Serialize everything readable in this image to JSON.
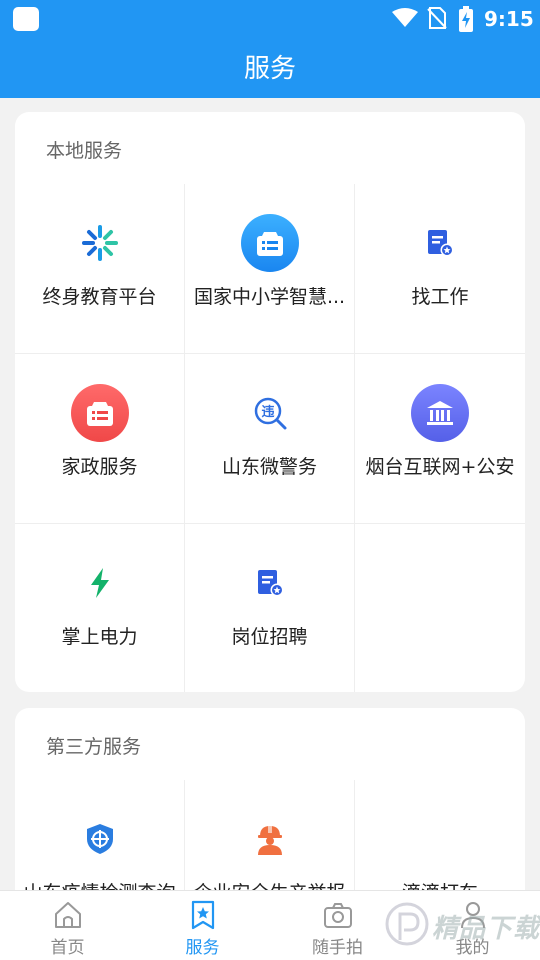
{
  "status_bar": {
    "time": "9:15"
  },
  "header": {
    "title": "服务"
  },
  "sections": [
    {
      "title": "本地服务",
      "items": [
        {
          "label": "终身教育平台",
          "icon": "lifelong-education-icon"
        },
        {
          "label": "国家中小学智慧...",
          "icon": "smart-education-icon"
        },
        {
          "label": "找工作",
          "icon": "job-document-icon"
        },
        {
          "label": "家政服务",
          "icon": "housekeeping-icon"
        },
        {
          "label": "山东微警务",
          "icon": "violation-search-icon"
        },
        {
          "label": "烟台互联网+公安",
          "icon": "police-building-icon"
        },
        {
          "label": "掌上电力",
          "icon": "lightning-icon"
        },
        {
          "label": "岗位招聘",
          "icon": "recruitment-document-icon"
        }
      ]
    },
    {
      "title": "第三方服务",
      "items": [
        {
          "label": "山东疫情检测查询",
          "icon": "shield-target-icon"
        },
        {
          "label": "企业安全生产举报",
          "icon": "worker-helmet-icon"
        },
        {
          "label": "滴滴打车",
          "icon": ""
        }
      ]
    }
  ],
  "tabs": [
    {
      "label": "首页",
      "icon": "home-icon",
      "active": false
    },
    {
      "label": "服务",
      "icon": "bookmark-star-icon",
      "active": true
    },
    {
      "label": "随手拍",
      "icon": "camera-icon",
      "active": false
    },
    {
      "label": "我的",
      "icon": "user-icon",
      "active": false
    }
  ],
  "watermark": {
    "text": "精品下载"
  },
  "colors": {
    "primary": "#2196f3",
    "red": "#f45a5a",
    "green": "#13b26a",
    "indigo": "#6a72f0",
    "orange": "#f07040"
  }
}
